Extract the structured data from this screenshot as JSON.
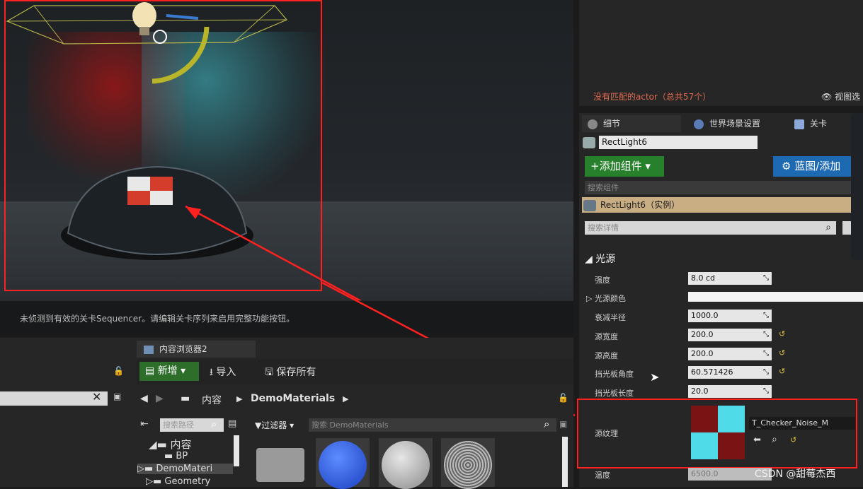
{
  "viewport": {
    "status_message": "未侦测到有效的关卡Sequencer。请编辑关卡序列来启用完整功能按钮。"
  },
  "outliner": {
    "no_match": "没有匹配的actor（总共57个）",
    "view_options": "视图选"
  },
  "details": {
    "tabs": [
      {
        "label": "细节"
      },
      {
        "label": "世界场景设置"
      },
      {
        "label": "关卡"
      }
    ],
    "actor_name": "RectLight6",
    "add_component": "+添加组件",
    "blueprint": "蓝图/添加",
    "component_search_placeholder": "搜索组件",
    "component_instance": "RectLight6（实例）",
    "details_search_placeholder": "搜索详情",
    "section": "光源",
    "props": [
      {
        "label": "强度",
        "value": "8.0 cd"
      },
      {
        "label": "光源颜色",
        "value": ""
      },
      {
        "label": "衰减半径",
        "value": "1000.0"
      },
      {
        "label": "源宽度",
        "value": "200.0"
      },
      {
        "label": "源高度",
        "value": "200.0"
      },
      {
        "label": "挡光板角度",
        "value": "60.571426"
      },
      {
        "label": "挡光板长度",
        "value": "20.0"
      },
      {
        "label": "源纹理",
        "value": "T_Checker_Noise_M"
      },
      {
        "label": "温度",
        "value": "6500.0"
      }
    ]
  },
  "content_browser": {
    "tab_label": "内容浏览器2",
    "new_label": "新增",
    "import_label": "导入",
    "save_all_label": "保存所有",
    "crumb_root": "内容",
    "crumb_folder": "DemoMaterials",
    "path_search_placeholder": "搜索路径",
    "filter_label": "过滤器",
    "asset_search_placeholder": "搜索 DemoMaterials",
    "tree": [
      "内容",
      "BP",
      "DemoMateri",
      "Geometry"
    ]
  },
  "watermark": "CSDN @甜莓杰西",
  "colors": {
    "annotation_red": "#ff2020",
    "add_green": "#27802b",
    "blueprint_blue": "#1d6ab2",
    "checker_red": "#7a1414",
    "checker_cyan": "#4fdbe8"
  }
}
